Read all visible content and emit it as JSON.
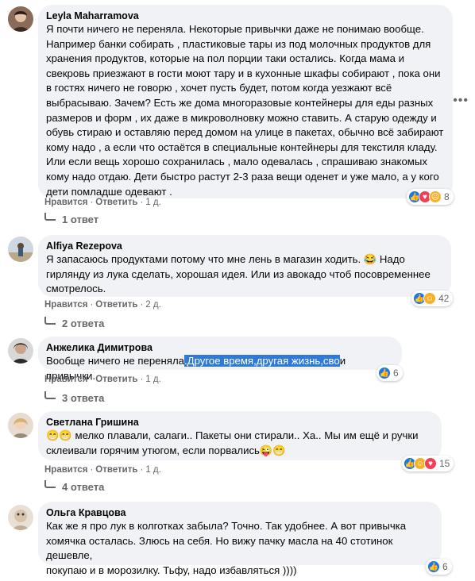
{
  "comments": [
    {
      "author": "Leyla Maharramova",
      "text": "Я почти ничего не переняла. Некоторые привычки даже не понимаю вообще.\nНапример банки собирать , пластиковые тары из под молочных продуктов для\nхранения продуктов, которые на пол порции таки остались. Когда мама и\nсвекровь приезжают в гости моют тару и в кухонные шкафы собирают , пока они\nв гостях ничего не говорю , хочет пусть будет, потом когда уезжают всё\nвыбрасываю. Зачем? Есть же дома многоразовые контейнеры для еды разных\nразмеров и форм , их даже в микроволновку можно ставить. А старую одежду и\nобувь стираю и оставляю перед домом на улице в пакетах, обычно всё забирают\nкому надо , а если что остаётся в специальные контейнеры для текстиля кладу.\nИли если вещь хорошо сохранилась , мало одевалась , спрашиваю знакомых\nкому надо отдаю. Дети быстро растут 2-3 раза вещи оденет и уже мало, а у кого\nдети помладше одевают .",
      "reaction_count": "8",
      "like": "Нравится",
      "reply": "Ответить",
      "time": "1 д.",
      "replies": "1 ответ"
    },
    {
      "author": "Alfiya Rezepova",
      "text": "Я запасаюсь продуктами потому что мне лень в магазин ходить. 😂 Надо\nгирлянду из лука сделать, хорошая идея. Или из авокадо чтоб посовременнее\nсмотрелось.",
      "reaction_count": "42",
      "like": "Нравится",
      "reply": "Ответить",
      "time": "2 д.",
      "replies": "2 ответа"
    },
    {
      "author": "Анжелика Димитрова",
      "text_before": "Вообще ничего не переняла",
      "text_highlight": ".Другое время,другая жизнь,сво",
      "text_after": "и привычки.",
      "reaction_count": "6",
      "like": "Нравится",
      "reply": "Ответить",
      "time": "1 д.",
      "replies": "3 ответа"
    },
    {
      "author": "Светлана Гришина",
      "text": "😁😁 мелко плавали, салаги.. Пакеты они стирали.. Ха.. Мы им ещё и ручки\nсклеивали горячим утюгом, если порвались😜😁",
      "reaction_count": "15",
      "like": "Нравится",
      "reply": "Ответить",
      "time": "1 д.",
      "replies": "4 ответа"
    },
    {
      "author": "Ольга Кравцова",
      "text": "Как же я про лук в колготках забыла? Точно. Так удобнее. А вот привычка\nхомячка осталась. Злюсь на себя. Но вижу пачку масла на 40 стотинок дешевле,\nпокупаю и в морозилку. Тьфу, надо избавляться ))))",
      "reaction_count": "6"
    }
  ],
  "icons": {
    "more": "more-options-icon",
    "like": "like-reaction-icon",
    "heart": "love-reaction-icon",
    "haha": "haha-reaction-icon",
    "sad": "sad-reaction-icon"
  },
  "colors": {
    "bubble": "#f0f2f5",
    "like_blue": "#1877f2",
    "meta_gray": "#65676b",
    "highlight": "#2f7ad9"
  }
}
